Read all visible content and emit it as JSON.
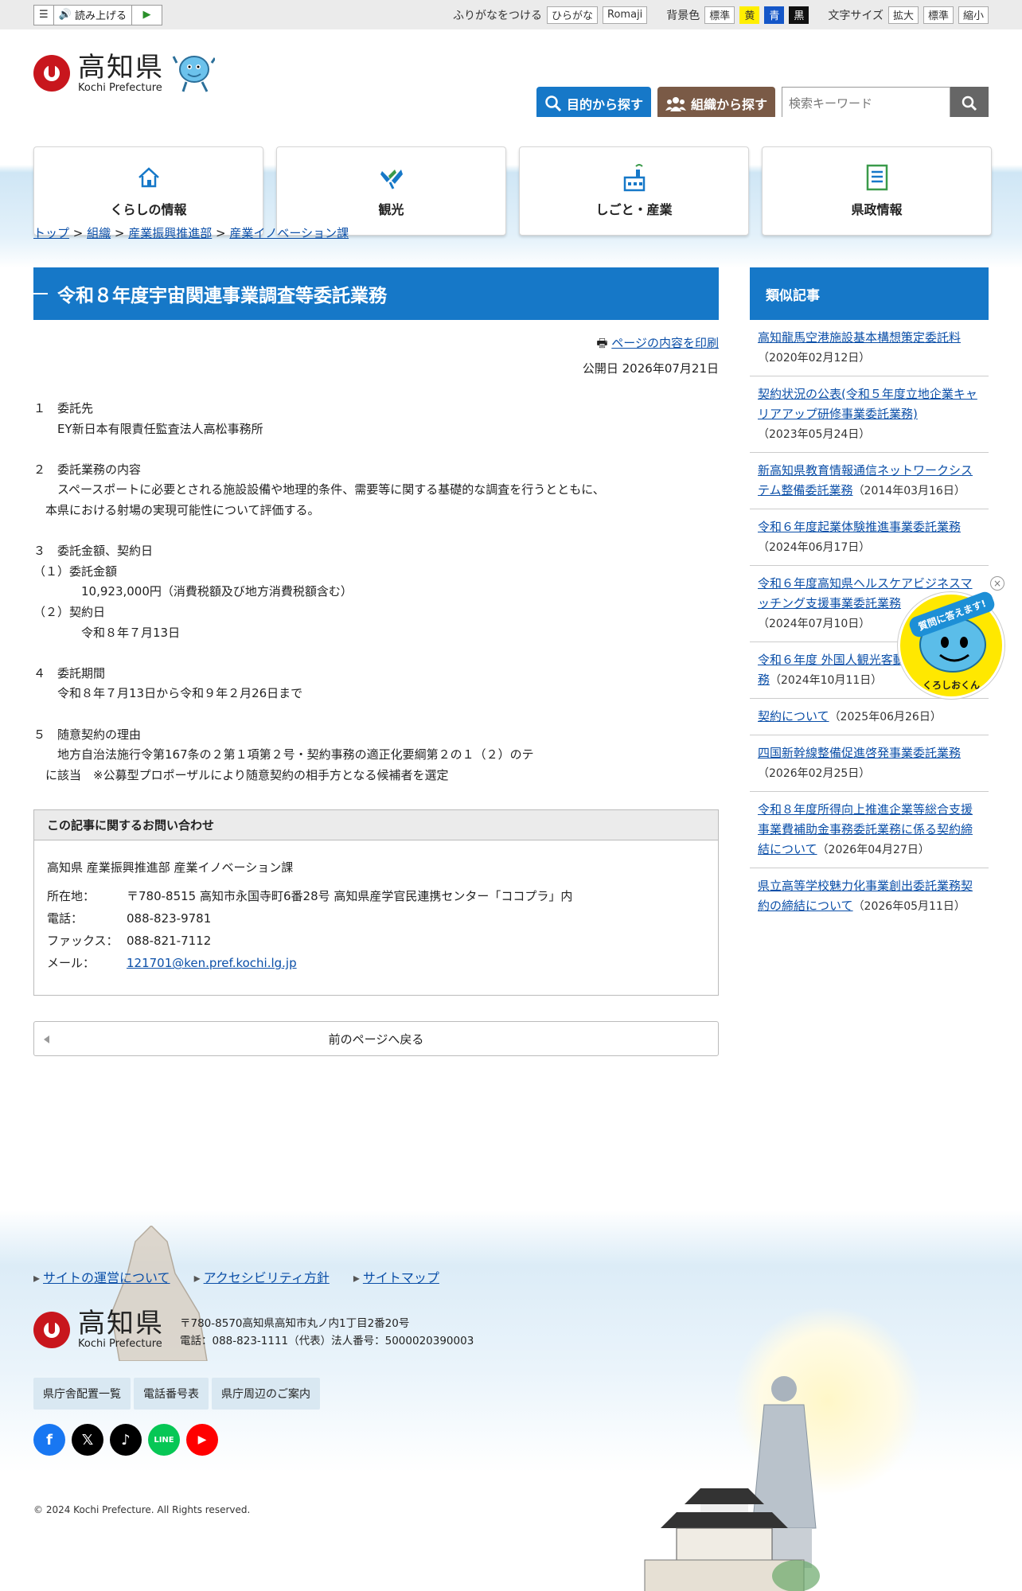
{
  "topbar": {
    "read_aloud": "読み上げる",
    "furigana": "ふりがなをつける",
    "hiragana": "ひらがな",
    "romaji": "Romaji",
    "bg_label": "背景色",
    "bg_standard": "標準",
    "bg_yellow": "黄",
    "bg_blue": "青",
    "bg_black": "黒",
    "font_label": "文字サイズ",
    "font_large": "拡大",
    "font_standard": "標準",
    "font_small": "縮小"
  },
  "header": {
    "logo_jp": "高知県",
    "logo_en": "Kochi Prefecture",
    "purpose_button": "目的から探す",
    "org_button": "組織から探す",
    "search_placeholder": "検索キーワード"
  },
  "nav": [
    {
      "label": "くらしの情報"
    },
    {
      "label": "観光"
    },
    {
      "label": "しごと・産業"
    },
    {
      "label": "県政情報"
    }
  ],
  "breadcrumb": [
    "トップ",
    "組織",
    "産業振興推進部",
    "産業イノベーション課"
  ],
  "article": {
    "title": "令和８年度宇宙関連事業調査等委託業務",
    "print_link": "ページの内容を印刷",
    "published": "公開日 2026年07月21日",
    "body": "１　委託先\n　　EY新日本有限責任監査法人高松事務所\n\n２　委託業務の内容\n　　スペースポートに必要とされる施設設備や地理的条件、需要等に関する基礎的な調査を行うとともに、\n　本県における射場の実現可能性について評価する。\n\n３　委託金額、契約日\n（１）委託金額\n　　　　10,923,000円（消費税額及び地方消費税額含む）\n（２）契約日\n　　　　令和８年７月13日\n\n４　委託期間\n　　令和８年７月13日から令和９年２月26日まで\n\n５　随意契約の理由\n　　地方自治法施行令第167条の２第１項第２号・契約事務の適正化要綱第２の１（２）のテ\n　に該当　※公募型プロポーザルにより随意契約の相手方となる候補者を選定"
  },
  "contact": {
    "heading": "この記事に関するお問い合わせ",
    "dept": "高知県 産業振興推進部 産業イノベーション課",
    "address_label": "所在地：",
    "address": "〒780-8515 高知市永国寺町6番28号 高知県産学官民連携センター「ココプラ」内",
    "phone_label": "電話：",
    "phone": "088-823-9781",
    "fax_label": "ファックス：",
    "fax": "088-821-7112",
    "mail_label": "メール：",
    "mail": "121701@ken.pref.kochi.lg.jp"
  },
  "back_button": "前のページへ戻る",
  "sidebar": {
    "heading": "類似記事",
    "items": [
      {
        "title": "高知龍馬空港施設基本構想策定委託料",
        "date": "（2020年02月12日）"
      },
      {
        "title": "契約状況の公表(令和５年度立地企業キャリアアップ研修事業委託業務)",
        "date": "（2023年05月24日）"
      },
      {
        "title": "新高知県教育情報通信ネットワークシステム整備委託業務",
        "date": "（2014年03月16日）"
      },
      {
        "title": "令和６年度起業体験推進事業委託業務",
        "date": "（2024年06月17日）"
      },
      {
        "title": "令和６年度高知県ヘルスケアビジネスマッチング支援事業委託業務",
        "date": "（2024年07月10日）"
      },
      {
        "title": "令和６年度 外国人観光客動向調査委託業務",
        "date": "（2024年10月11日）"
      },
      {
        "title": "契約について",
        "date": "（2025年06月26日）"
      },
      {
        "title": "四国新幹線整備促進啓発事業委託業務",
        "date": "（2026年02月25日）"
      },
      {
        "title": "令和８年度所得向上推進企業等総合支援事業費補助金事務委託業務に係る契約締結について",
        "date": "（2026年04月27日）"
      },
      {
        "title": "県立高等学校魅力化事業創出委託業務契約の締結について",
        "date": "（2026年05月11日）"
      }
    ]
  },
  "kuroshio": {
    "ribbon": "質問に答えます!",
    "name": "くろしおくん",
    "close": "×"
  },
  "footer": {
    "links": [
      "サイトの運営について",
      "アクセシビリティ方針",
      "サイトマップ"
    ],
    "logo_jp": "高知県",
    "logo_en": "Kochi Prefecture",
    "address": "〒780-8570高知県高知市丸ノ内1丁目2番20号",
    "phone": "電話：088-823-1111（代表）法人番号：5000020390003",
    "buttons": [
      "県庁舎配置一覧",
      "電話番号表",
      "県庁周辺のご案内"
    ],
    "social": [
      "facebook-icon",
      "x-icon",
      "tiktok-icon",
      "line-icon",
      "youtube-icon"
    ],
    "copyright": "© 2024 Kochi Prefecture. All Rights reserved."
  }
}
